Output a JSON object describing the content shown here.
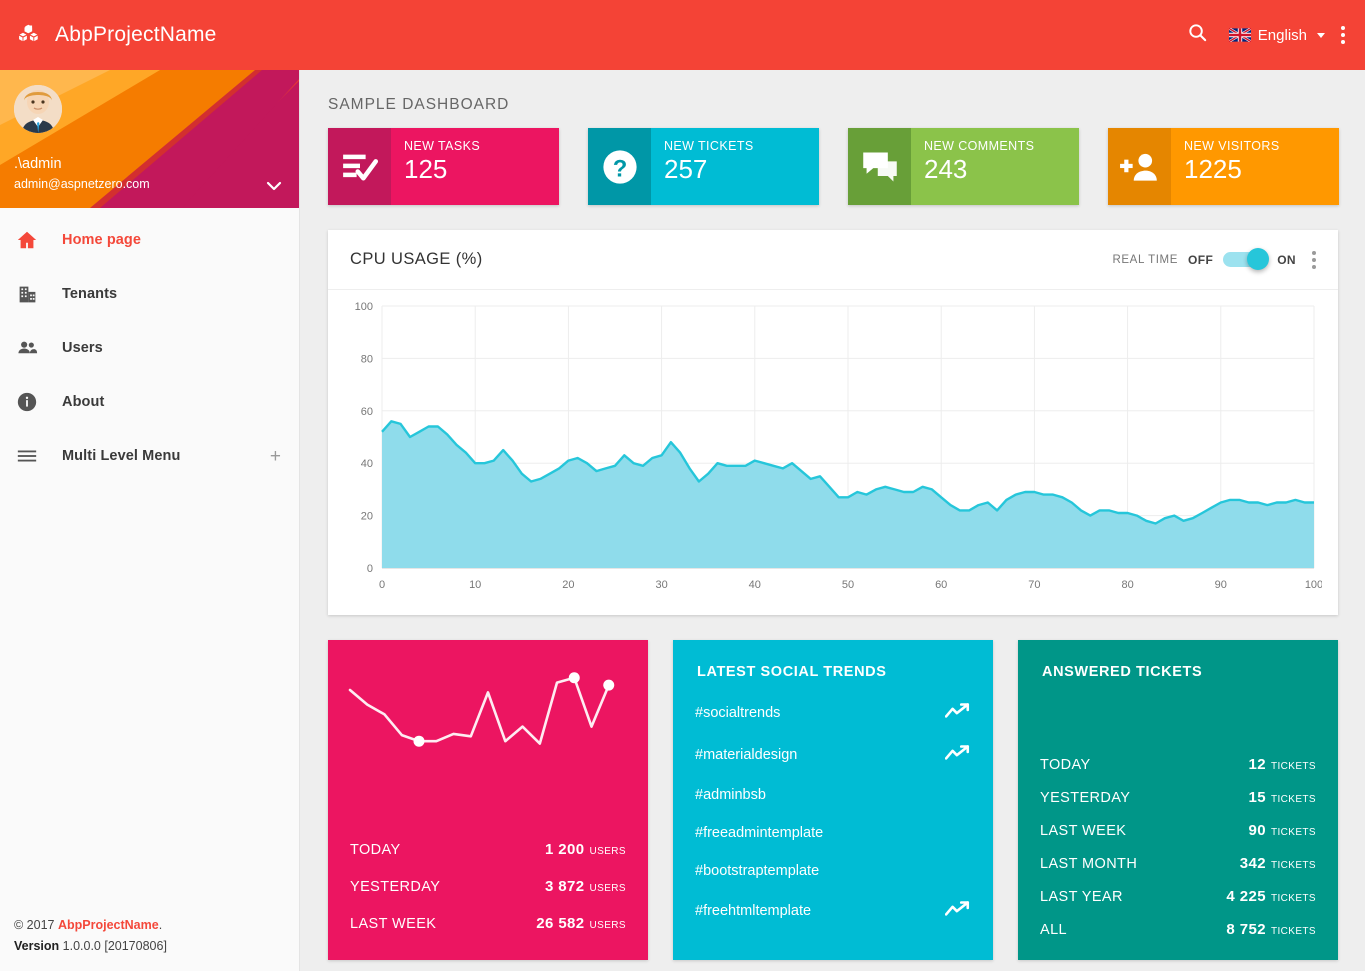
{
  "topbar": {
    "brand": "AbpProjectName",
    "brand_icon": "cubes-icon",
    "search_icon": "search-icon",
    "language": "English",
    "language_flag_icon": "uk-flag-icon",
    "menu_icon": "vertical-dots-icon",
    "bg_color": "#f44336"
  },
  "sidebar": {
    "user": {
      "name": ".\\admin",
      "email": "admin@aspnetzero.com",
      "avatar_icon": "user-avatar",
      "expand_icon": "chevron-down-icon"
    },
    "items": [
      {
        "label": "Home page",
        "icon": "home-icon",
        "active": true,
        "expand": ""
      },
      {
        "label": "Tenants",
        "icon": "building-icon",
        "active": false,
        "expand": ""
      },
      {
        "label": "Users",
        "icon": "people-icon",
        "active": false,
        "expand": ""
      },
      {
        "label": "About",
        "icon": "info-circle-icon",
        "active": false,
        "expand": ""
      },
      {
        "label": "Multi Level Menu",
        "icon": "hamburger-icon",
        "active": false,
        "expand": "+"
      }
    ],
    "footer": {
      "copyright_prefix": "© 2017 ",
      "copyright_project": "AbpProjectName",
      "copyright_suffix": ".",
      "version_label": "Version",
      "version_value": "1.0.0.0 [20170806]"
    }
  },
  "main": {
    "page_title": "SAMPLE DASHBOARD",
    "stats": [
      {
        "label": "NEW TASKS",
        "value": "125",
        "icon": "tasks-check-icon",
        "color": "#ec1561",
        "icon_color": "#c2185b"
      },
      {
        "label": "NEW TICKETS",
        "value": "257",
        "icon": "question-circle-icon",
        "color": "#00bcd4",
        "icon_color": "#0097a7"
      },
      {
        "label": "NEW COMMENTS",
        "value": "243",
        "icon": "comments-icon",
        "color": "#8bc34a",
        "icon_color": "#689f38"
      },
      {
        "label": "NEW VISITORS",
        "value": "1225",
        "icon": "person-add-icon",
        "color": "#ff9800",
        "icon_color": "#e58600"
      }
    ],
    "cpu_card": {
      "title": "CPU USAGE (%)",
      "realtime_label": "REAL TIME",
      "off_label": "OFF",
      "on_label": "ON",
      "toggle_state": "on",
      "menu_icon": "vertical-dots-icon"
    },
    "visitors_card": {
      "color": "#ec1561",
      "sparkline_color": "#ffffff",
      "rows": [
        {
          "label": "TODAY",
          "value": "1 200",
          "unit": "USERS"
        },
        {
          "label": "YESTERDAY",
          "value": "3 872",
          "unit": "USERS"
        },
        {
          "label": "LAST WEEK",
          "value": "26 582",
          "unit": "USERS"
        }
      ]
    },
    "social_card": {
      "title": "LATEST SOCIAL TRENDS",
      "color": "#00bcd4",
      "items": [
        {
          "label": "#socialtrends",
          "trend_icon": "trending-up-icon",
          "has_trend": true
        },
        {
          "label": "#materialdesign",
          "trend_icon": "trending-up-icon",
          "has_trend": true
        },
        {
          "label": "#adminbsb",
          "trend_icon": "",
          "has_trend": false
        },
        {
          "label": "#freeadmintemplate",
          "trend_icon": "",
          "has_trend": false
        },
        {
          "label": "#bootstraptemplate",
          "trend_icon": "",
          "has_trend": false
        },
        {
          "label": "#freehtmltemplate",
          "trend_icon": "trending-up-icon",
          "has_trend": true
        }
      ]
    },
    "tickets_card": {
      "title": "ANSWERED TICKETS",
      "color": "#009688",
      "rows": [
        {
          "label": "TODAY",
          "value": "12",
          "unit": "TICKETS"
        },
        {
          "label": "YESTERDAY",
          "value": "15",
          "unit": "TICKETS"
        },
        {
          "label": "LAST WEEK",
          "value": "90",
          "unit": "TICKETS"
        },
        {
          "label": "LAST MONTH",
          "value": "342",
          "unit": "TICKETS"
        },
        {
          "label": "LAST YEAR",
          "value": "4 225",
          "unit": "TICKETS"
        },
        {
          "label": "ALL",
          "value": "8 752",
          "unit": "TICKETS"
        }
      ]
    }
  },
  "chart_data": [
    {
      "type": "area",
      "title": "CPU USAGE (%)",
      "xlabel": "",
      "ylabel": "",
      "xlim": [
        0,
        100
      ],
      "ylim": [
        0,
        100
      ],
      "xticks": [
        0,
        10,
        20,
        30,
        40,
        50,
        60,
        70,
        80,
        90,
        100
      ],
      "yticks": [
        0,
        20,
        40,
        60,
        80,
        100
      ],
      "grid": true,
      "legend": "none",
      "line_color": "#26c6da",
      "fill_color": "#8fdceb",
      "x": [
        0,
        1,
        2,
        3,
        4,
        5,
        6,
        7,
        8,
        9,
        10,
        11,
        12,
        13,
        14,
        15,
        16,
        17,
        18,
        19,
        20,
        21,
        22,
        23,
        24,
        25,
        26,
        27,
        28,
        29,
        30,
        31,
        32,
        33,
        34,
        35,
        36,
        37,
        38,
        39,
        40,
        41,
        42,
        43,
        44,
        45,
        46,
        47,
        48,
        49,
        50,
        51,
        52,
        53,
        54,
        55,
        56,
        57,
        58,
        59,
        60,
        61,
        62,
        63,
        64,
        65,
        66,
        67,
        68,
        69,
        70,
        71,
        72,
        73,
        74,
        75,
        76,
        77,
        78,
        79,
        80,
        81,
        82,
        83,
        84,
        85,
        86,
        87,
        88,
        89,
        90,
        91,
        92,
        93,
        94,
        95,
        96,
        97,
        98,
        99,
        100
      ],
      "values": [
        52,
        56,
        55,
        50,
        52,
        54,
        54,
        51,
        47,
        44,
        40,
        40,
        41,
        45,
        41,
        36,
        33,
        34,
        36,
        38,
        41,
        42,
        40,
        37,
        38,
        39,
        43,
        40,
        39,
        42,
        43,
        48,
        44,
        38,
        33,
        36,
        40,
        39,
        39,
        39,
        41,
        40,
        39,
        38,
        40,
        37,
        34,
        35,
        31,
        27,
        27,
        29,
        28,
        30,
        31,
        30,
        29,
        29,
        31,
        30,
        27,
        24,
        22,
        22,
        24,
        25,
        22,
        26,
        28,
        29,
        29,
        28,
        28,
        27,
        25,
        22,
        20,
        22,
        22,
        21,
        21,
        20,
        18,
        17,
        19,
        20,
        18,
        19,
        21,
        23,
        25,
        26,
        26,
        25,
        25,
        24,
        25,
        25,
        26,
        25,
        25
      ]
    },
    {
      "type": "line",
      "title": "Visitors sparkline",
      "line_color": "#ffffff",
      "xlim": [
        0,
        16
      ],
      "ylim": [
        0,
        100
      ],
      "x": [
        0,
        1,
        2,
        3,
        4,
        5,
        6,
        7,
        8,
        9,
        10,
        11,
        12,
        13,
        14,
        15
      ],
      "values": [
        82,
        70,
        62,
        45,
        40,
        40,
        46,
        44,
        80,
        40,
        52,
        38,
        88,
        92,
        52,
        86
      ],
      "markers": [
        {
          "x": 4,
          "y": 40
        },
        {
          "x": 13,
          "y": 92
        },
        {
          "x": 15,
          "y": 86
        }
      ]
    }
  ]
}
